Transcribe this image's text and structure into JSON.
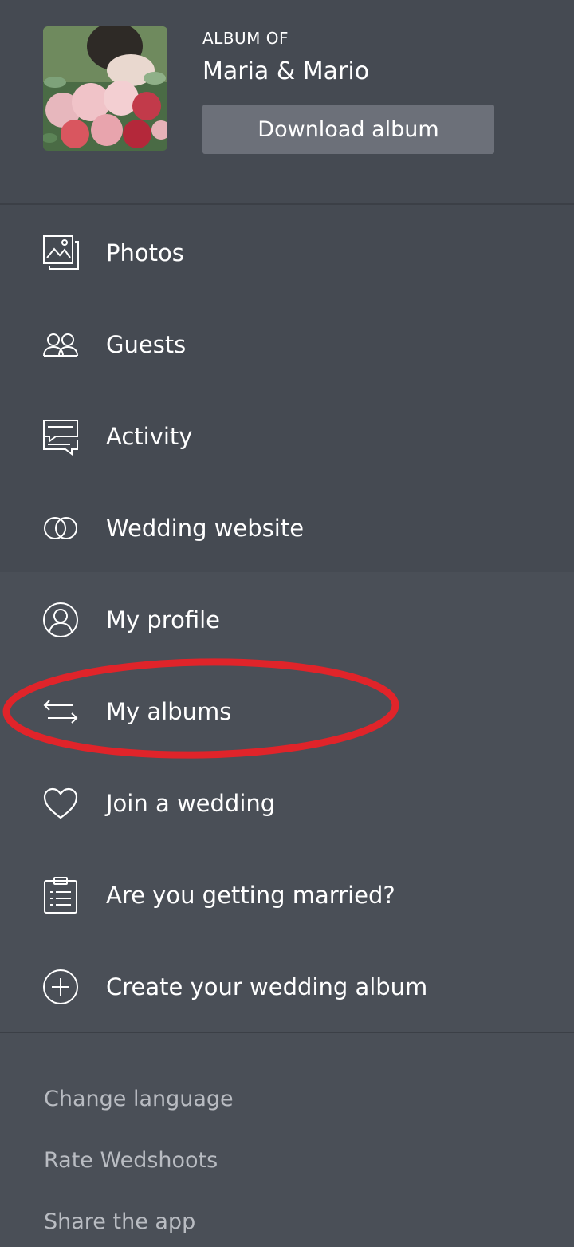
{
  "header": {
    "album_of_label": "ALBUM OF",
    "album_name": "Maria & Mario",
    "download_label": "Download album"
  },
  "menu_primary": [
    {
      "label": "Photos",
      "icon": "photos-icon"
    },
    {
      "label": "Guests",
      "icon": "guests-icon"
    },
    {
      "label": "Activity",
      "icon": "activity-icon"
    },
    {
      "label": "Wedding website",
      "icon": "rings-icon"
    }
  ],
  "menu_secondary": [
    {
      "label": "My profile",
      "icon": "profile-icon"
    },
    {
      "label": "My albums",
      "icon": "swap-arrows-icon"
    },
    {
      "label": "Join a wedding",
      "icon": "heart-icon"
    },
    {
      "label": "Are you getting married?",
      "icon": "clipboard-icon"
    },
    {
      "label": "Create your wedding album",
      "icon": "plus-circle-icon"
    }
  ],
  "footer": {
    "change_language": "Change language",
    "rate": "Rate Wedshoots",
    "share": "Share the app"
  },
  "colors": {
    "header_bg": "#454a52",
    "panel_bg": "#4a4f57",
    "button_bg": "#6c7079",
    "annotation_red": "#e0242a"
  }
}
